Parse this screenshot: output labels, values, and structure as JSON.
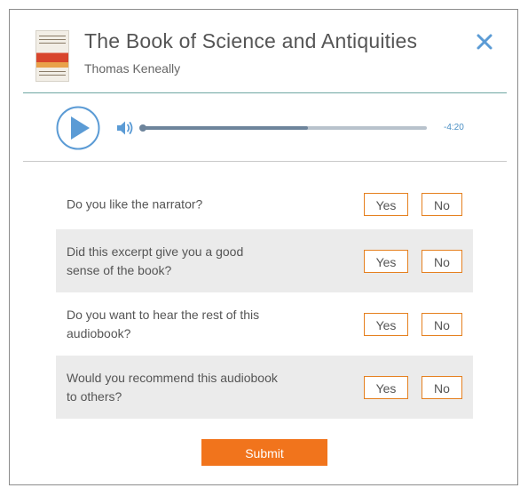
{
  "book": {
    "title": "The Book of Science and Antiquities",
    "author": "Thomas Keneally"
  },
  "player": {
    "time_remaining": "-4:20",
    "progress": 0.58
  },
  "questions": [
    {
      "text": "Do you like the narrator?",
      "yes_label": "Yes",
      "no_label": "No"
    },
    {
      "text": "Did this excerpt give you a good sense of the book?",
      "yes_label": "Yes",
      "no_label": "No"
    },
    {
      "text": "Do you want to hear the rest of this audiobook?",
      "yes_label": "Yes",
      "no_label": "No"
    },
    {
      "text": "Would you recommend this audiobook to others?",
      "yes_label": "Yes",
      "no_label": "No"
    }
  ],
  "submit_label": "Submit",
  "icons": {
    "close": "close-icon",
    "play": "play-icon",
    "volume": "volume-icon"
  },
  "colors": {
    "accent_blue": "#5b9bd5",
    "button_border": "#e5801f",
    "submit": "#f1741c"
  }
}
